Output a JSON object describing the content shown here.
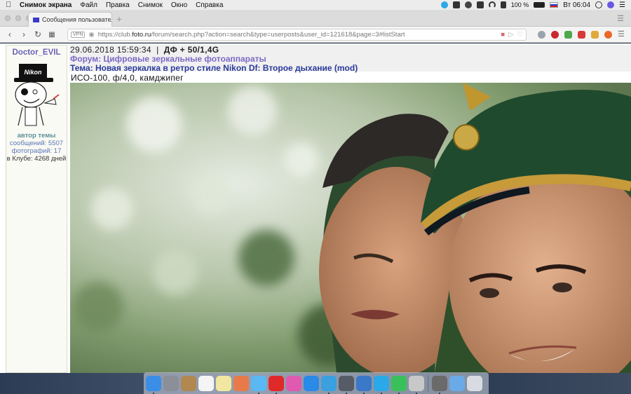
{
  "menubar": {
    "app_name": "Снимок экрана",
    "items": [
      "Файл",
      "Правка",
      "Снимок",
      "Окно",
      "Справка"
    ],
    "battery": "100 %",
    "clock": "Вт 06:04"
  },
  "browser": {
    "tab_title": "Сообщения пользователя D",
    "new_tab": "+",
    "vpn_badge": "VPN",
    "url_prefix": "https://club.",
    "url_domain": "foto.ru",
    "url_suffix": "/forum/search.php?action=search&type=userposts&user_id=121618&page=3#listStart"
  },
  "user": {
    "name": "Doctor_EVIL",
    "role": "автор темы",
    "messages": "сообщений: 5507",
    "photos": "фотографий: 17",
    "club": "в Клубе: 4268 дней",
    "avatar_text": "Nikon"
  },
  "post": {
    "datetime": "29.06.2018 15:59:34",
    "separator": "|",
    "camera": "ДФ + 50/1,4G",
    "forum": "Форум: Цифровые зеркальные фотоаппараты",
    "topic": "Тема: Новая зеркалка в ретро стиле Nikon Df: Второе дыхание (mod)",
    "caption": "ИСО-100, ф/4,0, камджипег"
  },
  "dock": {
    "apps": [
      {
        "name": "finder",
        "color": "#3a8ee6",
        "running": true
      },
      {
        "name": "launchpad",
        "color": "#8a8f98",
        "running": false
      },
      {
        "name": "notes-brown",
        "color": "#b08850",
        "running": false
      },
      {
        "name": "calendar",
        "color": "#f4f4f4",
        "running": false
      },
      {
        "name": "stickies",
        "color": "#f2e7a0",
        "running": false
      },
      {
        "name": "photos",
        "color": "#e87a4a",
        "running": false
      },
      {
        "name": "messages",
        "color": "#5ab8f2",
        "running": true
      },
      {
        "name": "opera",
        "color": "#e02a2a",
        "running": true
      },
      {
        "name": "itunes",
        "color": "#e05ab0",
        "running": false
      },
      {
        "name": "app-store",
        "color": "#2a8ae8",
        "running": false
      },
      {
        "name": "telegram",
        "color": "#3aa0e0",
        "running": true
      },
      {
        "name": "sequel",
        "color": "#555c66",
        "running": true
      },
      {
        "name": "network",
        "color": "#3a78c8",
        "running": true
      },
      {
        "name": "skype",
        "color": "#2aa8e8",
        "running": true
      },
      {
        "name": "whatsapp",
        "color": "#3ac05a",
        "running": true
      },
      {
        "name": "preview",
        "color": "#c8c8c8",
        "running": true
      },
      {
        "name": "screenshot",
        "color": "#6a6a6a",
        "running": true
      },
      {
        "name": "downloads-folder",
        "color": "#6aaae6",
        "running": false
      },
      {
        "name": "trash",
        "color": "#d8dce2",
        "running": false
      }
    ]
  }
}
